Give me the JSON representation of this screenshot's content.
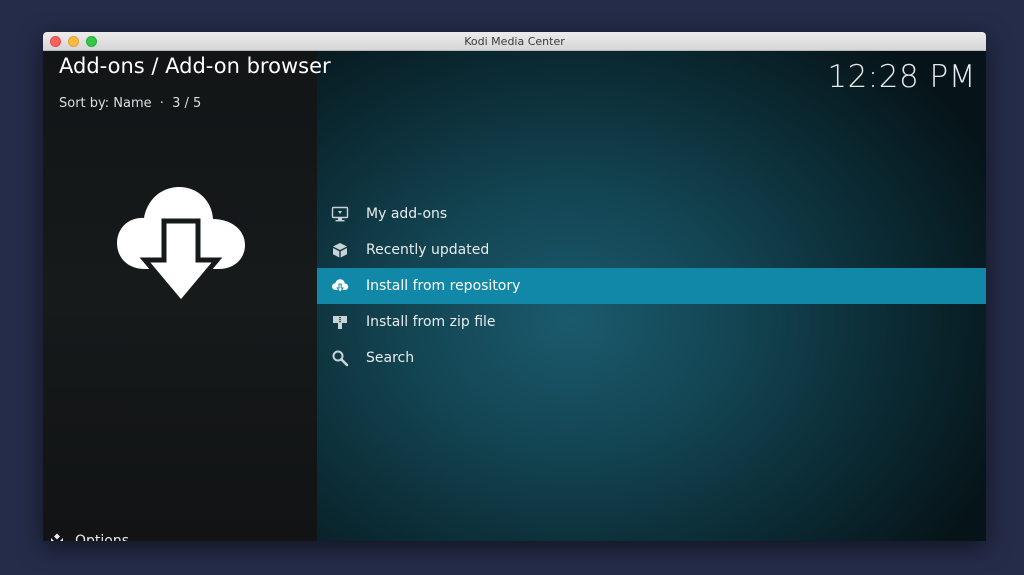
{
  "window": {
    "title": "Kodi Media Center"
  },
  "header": {
    "breadcrumb": "Add-ons / Add-on browser",
    "sort_label": "Sort by: Name",
    "separator": "·",
    "position": "3 / 5",
    "clock": "12:28 PM"
  },
  "hero": {
    "icon": "cloud-download-icon"
  },
  "menu": {
    "selected_index": 2,
    "items": [
      {
        "label": "My add-ons",
        "icon": "monitor-icon"
      },
      {
        "label": "Recently updated",
        "icon": "box-icon"
      },
      {
        "label": "Install from repository",
        "icon": "cloud-icon"
      },
      {
        "label": "Install from zip file",
        "icon": "zip-icon"
      },
      {
        "label": "Search",
        "icon": "search-icon"
      }
    ]
  },
  "footer": {
    "options_label": "Options",
    "options_icon": "kodi-options-icon"
  },
  "colors": {
    "accent": "#1188a8",
    "background": "#252c49"
  }
}
